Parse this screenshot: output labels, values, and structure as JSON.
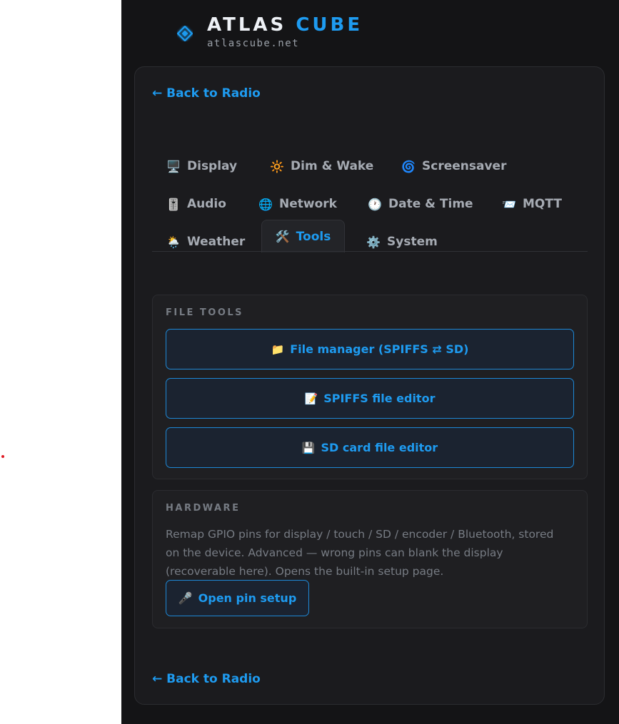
{
  "brand": {
    "title_main": "ATLAS",
    "title_accent": "CUBE",
    "subtitle": "atlascube.net",
    "accent_color": "#1e9bf0"
  },
  "nav": {
    "back_top": "← Back to Radio",
    "back_bottom": "← Back to Radio"
  },
  "tabs": [
    {
      "icon": "🖥️",
      "icon_name": "display-icon",
      "label": "Display"
    },
    {
      "icon": "🔆",
      "icon_name": "brightness-icon",
      "label": "Dim & Wake"
    },
    {
      "icon": "🌀",
      "icon_name": "swirl-icon",
      "label": "Screensaver"
    },
    {
      "icon": "🎚️",
      "icon_name": "audio-slider-icon",
      "label": "Audio"
    },
    {
      "icon": "🌐",
      "icon_name": "globe-icon",
      "label": "Network"
    },
    {
      "icon": "🕐",
      "icon_name": "clock-icon",
      "label": "Date & Time"
    },
    {
      "icon": "📨",
      "icon_name": "envelope-icon",
      "label": "MQTT"
    },
    {
      "icon": "🌦️",
      "icon_name": "weather-icon",
      "label": "Weather"
    },
    {
      "icon": "🛠️",
      "icon_name": "tools-icon",
      "label": "Tools",
      "active": true
    },
    {
      "icon": "⚙️",
      "icon_name": "gear-icon",
      "label": "System"
    }
  ],
  "file_tools": {
    "title": "FILE TOOLS",
    "buttons": [
      {
        "icon": "📁",
        "icon_name": "folder-icon",
        "label": "File manager (SPIFFS ⇄ SD)"
      },
      {
        "icon": "📝",
        "icon_name": "memo-icon",
        "label": "SPIFFS file editor"
      },
      {
        "icon": "💾",
        "icon_name": "floppy-disk-icon",
        "label": "SD card file editor"
      }
    ]
  },
  "hardware": {
    "title": "HARDWARE",
    "description": "Remap GPIO pins for display / touch / SD / encoder / Bluetooth, stored on the device. Advanced — wrong pins can blank the display (recoverable here). Opens the built-in setup page.",
    "button_icon": "🎤",
    "button_icon_name": "pin-icon",
    "button_label": "Open pin setup"
  }
}
